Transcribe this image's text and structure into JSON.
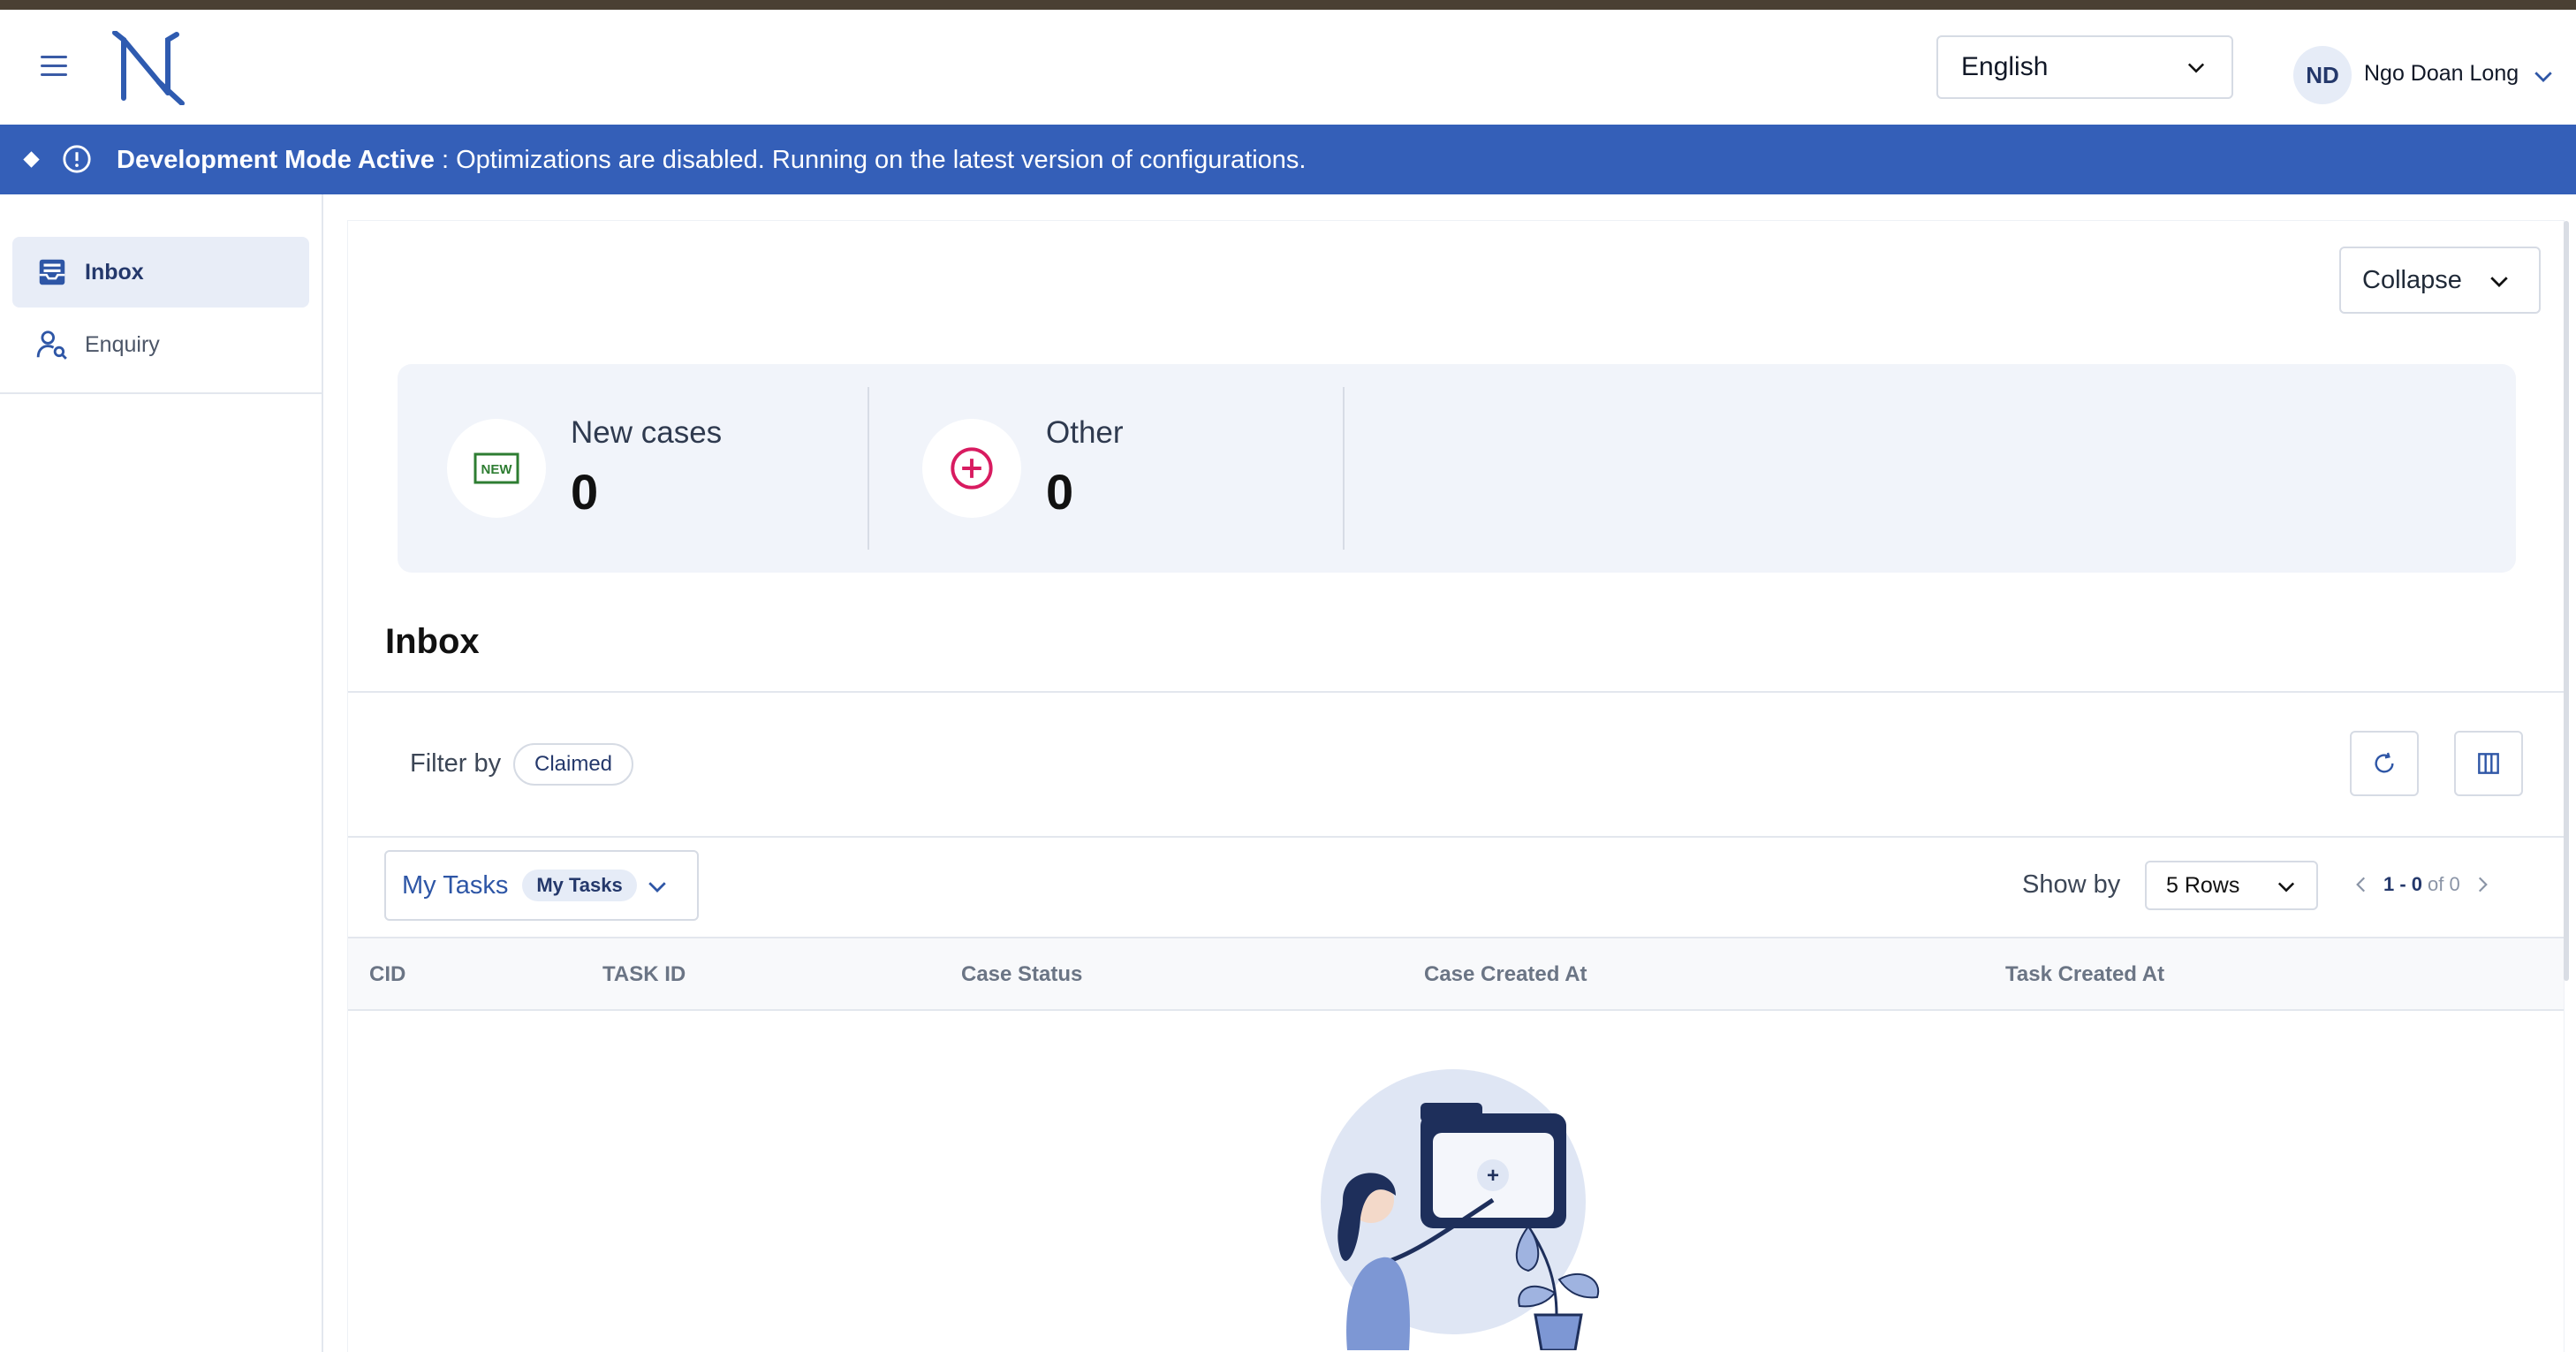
{
  "header": {
    "language": "English",
    "user_initials": "ND",
    "user_name": "Ngo Doan Long"
  },
  "banner": {
    "title": "Development Mode Active",
    "message": " : Optimizations are disabled. Running on the latest version of configurations."
  },
  "sidebar": {
    "items": [
      {
        "label": "Inbox",
        "icon": "inbox-icon",
        "active": true
      },
      {
        "label": "Enquiry",
        "icon": "user-search-icon",
        "active": false
      }
    ]
  },
  "main": {
    "collapse_label": "Collapse",
    "stats": [
      {
        "label": "New cases",
        "value": "0",
        "icon": "new-badge-icon"
      },
      {
        "label": "Other",
        "value": "0",
        "icon": "plus-circle-icon"
      }
    ],
    "inbox_title": "Inbox",
    "filter": {
      "label": "Filter by",
      "chip": "Claimed"
    },
    "task_selector": {
      "label": "My Tasks",
      "badge": "My Tasks"
    },
    "pagination": {
      "show_by_label": "Show by",
      "rows_option": "5 Rows",
      "range": "1 - 0",
      "of": "of 0"
    },
    "table": {
      "columns": [
        "CID",
        "TASK ID",
        "Case Status",
        "Case Created At",
        "Task Created At"
      ],
      "rows": []
    }
  },
  "colors": {
    "banner": "#345fb8",
    "accent": "#2e56a6",
    "new_icon": "#2e7d32",
    "other_icon": "#d81b60"
  }
}
